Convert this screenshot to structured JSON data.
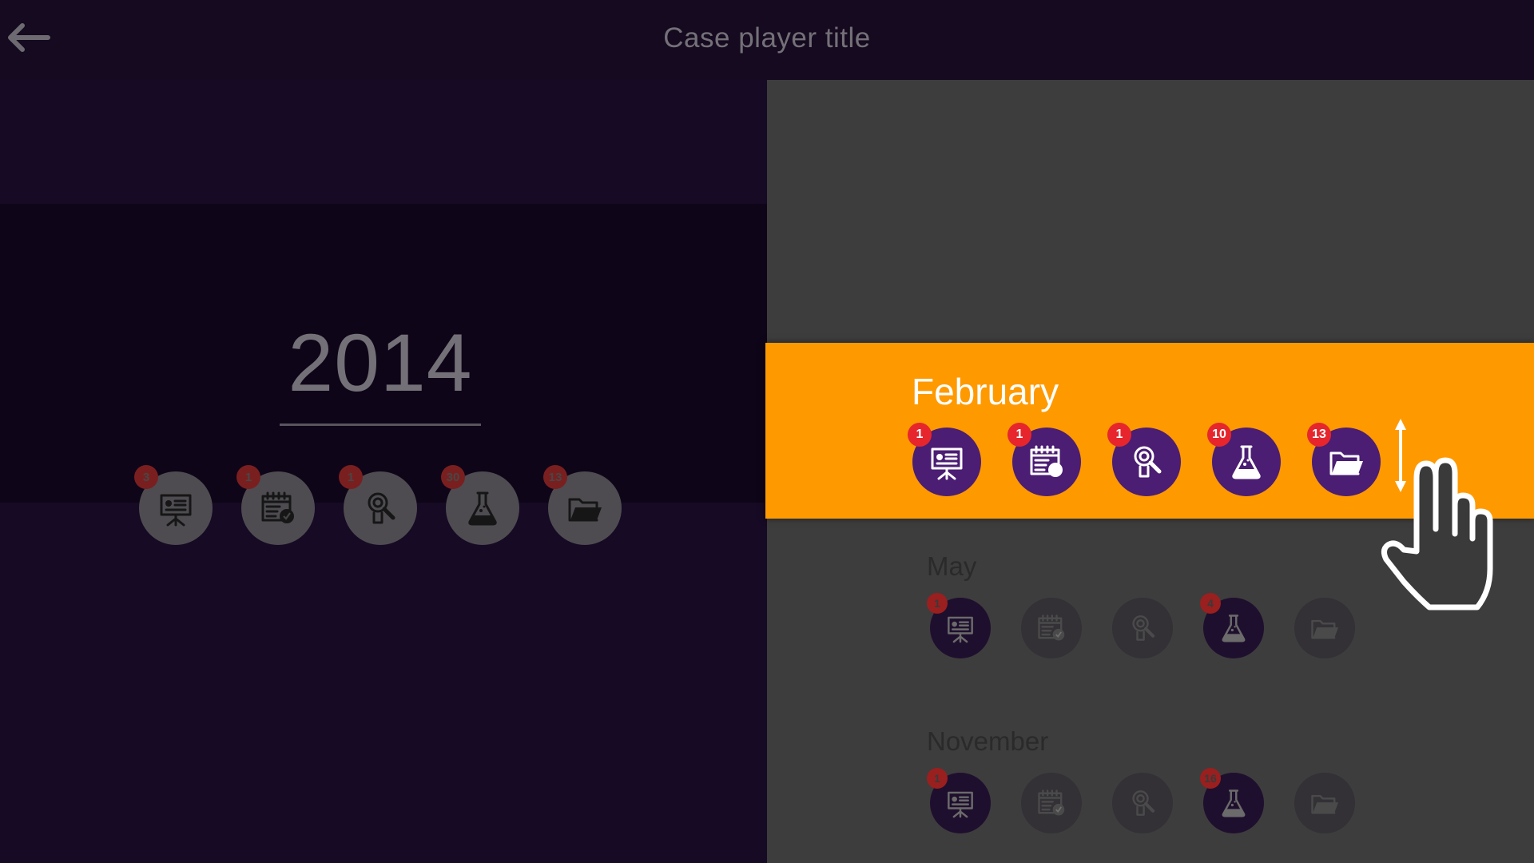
{
  "header": {
    "title": "Case player title",
    "back_icon": "back-arrow-icon"
  },
  "year": {
    "label": "2014",
    "items": [
      {
        "type": "presentation",
        "icon": "presentation-icon",
        "count": "3"
      },
      {
        "type": "calendar",
        "icon": "calendar-icon",
        "count": "1"
      },
      {
        "type": "search",
        "icon": "magnifier-icon",
        "count": "1"
      },
      {
        "type": "lab",
        "icon": "flask-icon",
        "count": "30"
      },
      {
        "type": "folder",
        "icon": "folder-icon",
        "count": "13"
      }
    ]
  },
  "months": [
    {
      "name": "February",
      "featured": true,
      "items": [
        {
          "type": "presentation",
          "icon": "presentation-icon",
          "count": "1"
        },
        {
          "type": "calendar",
          "icon": "calendar-icon",
          "count": "1"
        },
        {
          "type": "search",
          "icon": "magnifier-icon",
          "count": "1"
        },
        {
          "type": "lab",
          "icon": "flask-icon",
          "count": "10"
        },
        {
          "type": "folder",
          "icon": "folder-icon",
          "count": "13"
        }
      ]
    },
    {
      "name": "May",
      "featured": false,
      "items": [
        {
          "type": "presentation",
          "icon": "presentation-icon",
          "count": "1"
        },
        {
          "type": "calendar",
          "icon": "calendar-icon",
          "count": null
        },
        {
          "type": "search",
          "icon": "magnifier-icon",
          "count": null
        },
        {
          "type": "lab",
          "icon": "flask-icon",
          "count": "4"
        },
        {
          "type": "folder",
          "icon": "folder-icon",
          "count": null
        }
      ]
    },
    {
      "name": "November",
      "featured": false,
      "items": [
        {
          "type": "presentation",
          "icon": "presentation-icon",
          "count": "1"
        },
        {
          "type": "calendar",
          "icon": "calendar-icon",
          "count": null
        },
        {
          "type": "search",
          "icon": "magnifier-icon",
          "count": null
        },
        {
          "type": "lab",
          "icon": "flask-icon",
          "count": "16"
        },
        {
          "type": "folder",
          "icon": "folder-icon",
          "count": null
        }
      ]
    }
  ],
  "gesture": {
    "arrow_icon": "vertical-double-arrow-icon",
    "hand_icon": "swipe-hand-icon"
  },
  "colors": {
    "accent_orange": "#ff9900",
    "icon_purple": "#4b1d73",
    "badge_red": "#e6262c",
    "topbar": "#150a1f",
    "right_panel": "#3d3d3d"
  }
}
